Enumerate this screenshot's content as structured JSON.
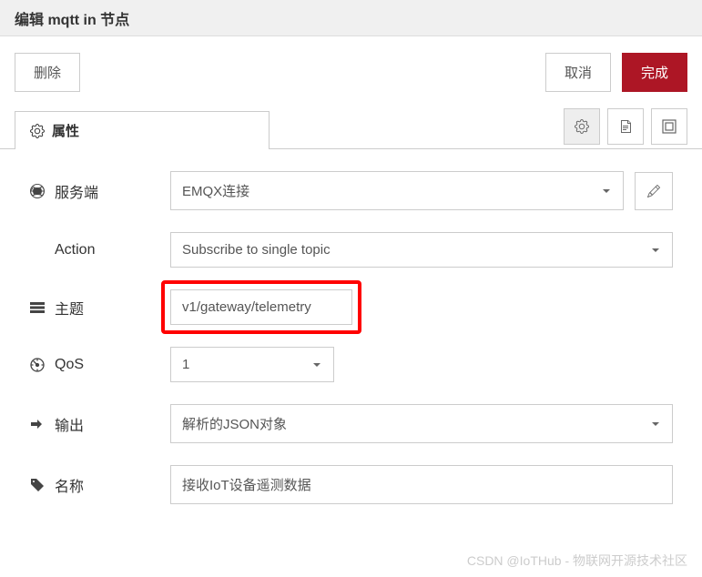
{
  "header": {
    "title": "编辑 mqtt in 节点"
  },
  "buttons": {
    "delete": "删除",
    "cancel": "取消",
    "done": "完成"
  },
  "tab": {
    "properties": "属性"
  },
  "form": {
    "server": {
      "label": "服务端",
      "value": "EMQX连接"
    },
    "action": {
      "label": "Action",
      "value": "Subscribe to single topic"
    },
    "topic": {
      "label": "主题",
      "value": "v1/gateway/telemetry"
    },
    "qos": {
      "label": "QoS",
      "value": "1"
    },
    "output": {
      "label": "输出",
      "value": "解析的JSON对象"
    },
    "name": {
      "label": "名称",
      "value": "接收IoT设备遥测数据"
    }
  },
  "watermark": "CSDN @IoTHub - 物联网开源技术社区"
}
